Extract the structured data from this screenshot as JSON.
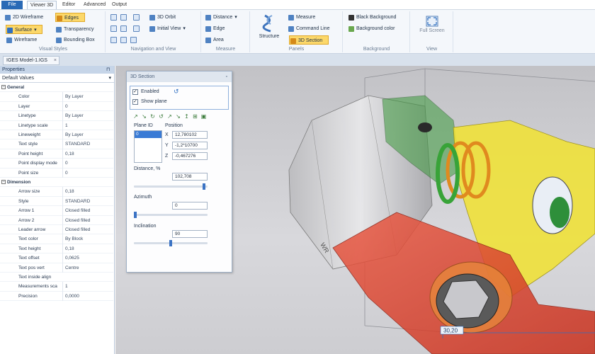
{
  "menu_tabs": [
    "File",
    "Viewer 3D",
    "Editor",
    "Advanced",
    "Output"
  ],
  "ribbon": {
    "visual_styles": {
      "label": "Visual Styles",
      "items": [
        "2D Wireframe",
        "Edges",
        "Surface",
        "Transparency",
        "Wireframe",
        "Bounding Box"
      ]
    },
    "navigation": {
      "label": "Navigation and View",
      "items": [
        "3D Orbit",
        "Initial View"
      ]
    },
    "measure": {
      "label": "Measure",
      "items": [
        "Distance",
        "Edge",
        "Area"
      ]
    },
    "panels": {
      "label": "Panels",
      "big": "Structure",
      "items": [
        "Measure",
        "Command Line",
        "3D Section"
      ]
    },
    "background": {
      "label": "Background",
      "items": [
        "Black Background",
        "Background color"
      ]
    },
    "view": {
      "label": "View",
      "big": "Full Screen"
    }
  },
  "document_tab": "IGES Model-1.IGS",
  "properties": {
    "title": "Properties",
    "selector": "Default Values",
    "rows": [
      {
        "key": "General",
        "value": "",
        "section": true
      },
      {
        "key": "Color",
        "value": "By Layer"
      },
      {
        "key": "Layer",
        "value": "0"
      },
      {
        "key": "Linetype",
        "value": "By Layer"
      },
      {
        "key": "Linetype scale",
        "value": "1"
      },
      {
        "key": "Lineweight",
        "value": "By Layer"
      },
      {
        "key": "Text style",
        "value": "STANDARD"
      },
      {
        "key": "Point height",
        "value": "0,18"
      },
      {
        "key": "Point display mode",
        "value": "0"
      },
      {
        "key": "Point size",
        "value": "0"
      },
      {
        "key": "Dimension",
        "value": "",
        "section": true
      },
      {
        "key": "Arrow size",
        "value": "0,18"
      },
      {
        "key": "Style",
        "value": "STANDARD"
      },
      {
        "key": "Arrow 1",
        "value": "Closed filled"
      },
      {
        "key": "Arrow 2",
        "value": "Closed filled"
      },
      {
        "key": "Leader arrow",
        "value": "Closed filled"
      },
      {
        "key": "Text color",
        "value": "By Block"
      },
      {
        "key": "Text height",
        "value": "0,18"
      },
      {
        "key": "Text offset",
        "value": "0,0625"
      },
      {
        "key": "Text pos vert",
        "value": "Centre"
      },
      {
        "key": "Text inside align",
        "value": ""
      },
      {
        "key": "Measurements sca",
        "value": "1"
      },
      {
        "key": "Precision",
        "value": "0,0000"
      }
    ]
  },
  "section_panel": {
    "title": "3D Section",
    "enabled": "Enabled",
    "show_plane": "Show plane",
    "plane_id_label": "Plane ID",
    "plane_id_value": "0",
    "position_label": "Position",
    "x": "12,780102",
    "y": "-1,2*10700",
    "z": "-0,467276",
    "distance_label": "Distance, %",
    "distance_value": "102,708",
    "distance_level": 0.97,
    "azimuth_label": "Azimuth",
    "azimuth_value": "0",
    "azimuth_level": 0.0,
    "inclination_label": "Inclination",
    "inclination_value": "90",
    "inclination_level": 0.5
  },
  "viewport": {
    "dimension_label": "30,20"
  }
}
